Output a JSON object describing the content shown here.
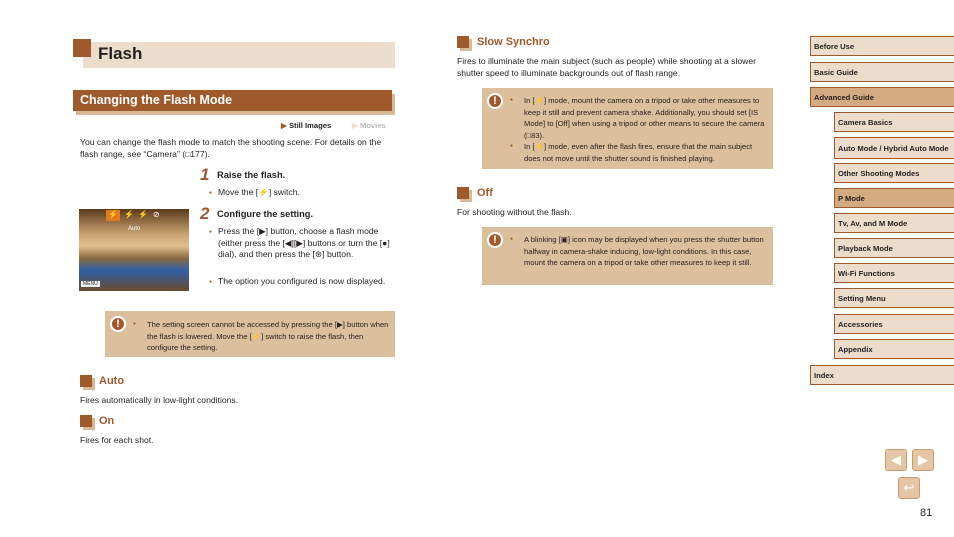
{
  "title": "Flash",
  "section": "Changing the Flash Mode",
  "modes": {
    "still": "Still Images",
    "movies": "Movies"
  },
  "intro": "You can change the flash mode to match the shooting scene. For details on the flash range, see “Camera” (□177).",
  "steps": [
    {
      "num": "1",
      "title": "Raise the flash.",
      "bullets": [
        "Move the [⚡] switch."
      ]
    },
    {
      "num": "2",
      "title": "Configure the setting.",
      "bullets": [
        "Press the [▶] button, choose a flash mode (either press the [◀][▶] buttons or turn the [●] dial), and then press the [⊛] button.",
        "The option you configured is now displayed."
      ]
    }
  ],
  "screen": {
    "label": "Auto",
    "menu": "MENU"
  },
  "note_left": "The setting screen cannot be accessed by pressing the [▶] button when the flash is lowered. Move the [⚡] switch to raise the flash, then configure the setting.",
  "auto": {
    "heading": "Auto",
    "text": "Fires automatically in low-light conditions."
  },
  "on": {
    "heading": "On",
    "text": "Fires for each shot."
  },
  "slow": {
    "heading": "Slow Synchro",
    "text": "Fires to illuminate the main subject (such as people) while shooting at a slower shutter speed to illuminate backgrounds out of flash range.",
    "notes": [
      "In [⚡] mode, mount the camera on a tripod or take other measures to keep it still and prevent camera shake. Additionally, you should set [IS Mode] to [Off] when using a tripod or other means to secure the camera (□83).",
      "In [⚡] mode, even after the flash fires, ensure that the main subject does not move until the shutter sound is finished playing."
    ]
  },
  "off": {
    "heading": "Off",
    "text": "For shooting without the flash.",
    "note": "A blinking [▣] icon may be displayed when you press the shutter button halfway in camera-shake inducing, low-light conditions. In this case, mount the camera on a tripod or take other measures to keep it still."
  },
  "sidebar": [
    {
      "label": "Before Use"
    },
    {
      "label": "Basic Guide"
    },
    {
      "label": "Advanced Guide",
      "active": true
    },
    {
      "label": "Camera Basics"
    },
    {
      "label": "Auto Mode / Hybrid Auto Mode"
    },
    {
      "label": "Other Shooting Modes"
    },
    {
      "label": "P Mode",
      "active": true
    },
    {
      "label": "Tv, Av, and M Mode"
    },
    {
      "label": "Playback Mode"
    },
    {
      "label": "Wi-Fi Functions"
    },
    {
      "label": "Setting Menu"
    },
    {
      "label": "Accessories"
    },
    {
      "label": "Appendix"
    },
    {
      "label": "Index"
    }
  ],
  "page_number": "81",
  "colors": {
    "accent": "#a0592a",
    "light": "#ecdccb",
    "note": "#dcbf9c"
  }
}
